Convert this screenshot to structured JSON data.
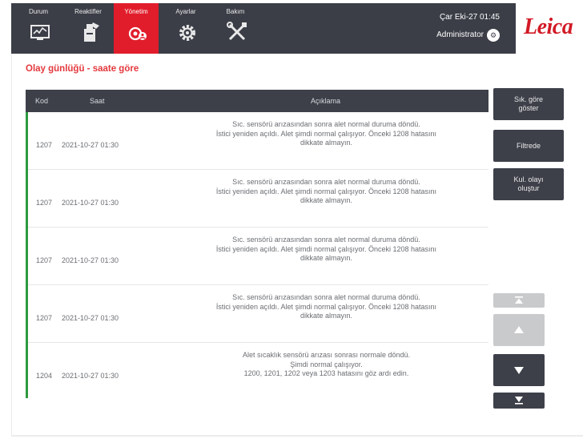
{
  "topbar": {
    "tabs": [
      {
        "label": "Durum",
        "icon": "status-screen-icon"
      },
      {
        "label": "Reaktifler",
        "icon": "reagent-bottle-icon"
      },
      {
        "label": "Yönetim",
        "icon": "admin-gear-user-icon"
      },
      {
        "label": "Ayarlar",
        "icon": "settings-gear-icon"
      },
      {
        "label": "Bakım",
        "icon": "maintenance-tools-icon"
      }
    ],
    "active_tab": "Yönetim",
    "datetime": "Çar Eki-27 01:45",
    "user": "Administrator",
    "logo": "Leica",
    "colors": {
      "bar": "#3b3e47",
      "active": "#e11d2c",
      "logo": "#d21a26"
    }
  },
  "page": {
    "title": "Olay günlüğü - saate göre"
  },
  "table": {
    "columns": {
      "code": "Kod",
      "time": "Saat",
      "desc": "Açıklama"
    },
    "rows": [
      {
        "code": "1207",
        "time": "2021-10-27 01:30",
        "desc": [
          "Sıc. sensörü arızasından sonra alet normal duruma döndü.",
          "İstici yeniden açıldı. Alet şimdi normal çalışıyor. Önceki 1208 hatasını",
          "dikkate almayın."
        ]
      },
      {
        "code": "1207",
        "time": "2021-10-27 01:30",
        "desc": [
          "Sıc. sensörü arızasından sonra alet normal duruma döndü.",
          "İstici yeniden açıldı. Alet şimdi normal çalışıyor. Önceki 1208 hatasını",
          "dikkate almayın."
        ]
      },
      {
        "code": "1207",
        "time": "2021-10-27 01:30",
        "desc": [
          "Sıc. sensörü arızasından sonra alet normal duruma döndü.",
          "İstici yeniden açıldı. Alet şimdi normal çalışıyor. Önceki 1208 hatasını",
          "dikkate almayın."
        ]
      },
      {
        "code": "1207",
        "time": "2021-10-27 01:30",
        "desc": [
          "Sıc. sensörü arızasından sonra alet normal duruma döndü.",
          "İstici yeniden açıldı. Alet şimdi normal çalışıyor. Önceki 1208 hatasını",
          "dikkate almayın."
        ]
      },
      {
        "code": "1204",
        "time": "2021-10-27 01:30",
        "desc": [
          "Alet sıcaklık sensörü arızası sonrası normale döndü.",
          "Şimdi normal çalışıyor.",
          "1200, 1201, 1202 veya 1203 hatasını göz ardı edin."
        ]
      }
    ]
  },
  "sidebar": {
    "buttons": [
      {
        "label": "Sık. göre göster"
      },
      {
        "label": "Filtrede"
      },
      {
        "label": "Kul. olayı oluştur"
      }
    ],
    "nav": [
      {
        "icon": "scroll-top-icon",
        "enabled": false
      },
      {
        "icon": "scroll-up-icon",
        "enabled": false
      },
      {
        "icon": "scroll-down-icon",
        "enabled": true
      },
      {
        "icon": "scroll-bottom-icon",
        "enabled": true
      }
    ]
  }
}
